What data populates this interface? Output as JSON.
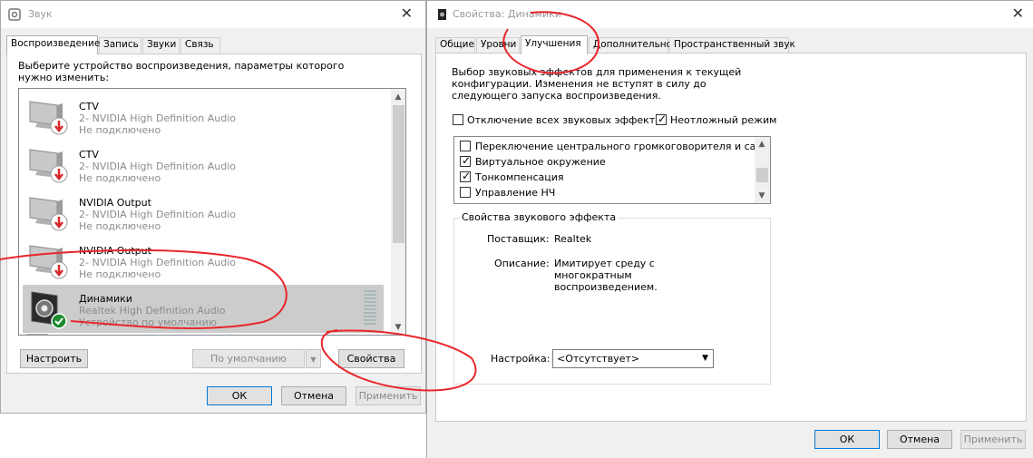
{
  "sound_window": {
    "title": "Звук",
    "tabs": [
      "Воспроизведение",
      "Запись",
      "Звуки",
      "Связь"
    ],
    "instruction": "Выберите устройство воспроизведения, параметры которого нужно изменить:",
    "devices": [
      {
        "name": "CTV",
        "driver": "2- NVIDIA High Definition Audio",
        "status": "Не подключено"
      },
      {
        "name": "CTV",
        "driver": "2- NVIDIA High Definition Audio",
        "status": "Не подключено"
      },
      {
        "name": "NVIDIA Output",
        "driver": "2- NVIDIA High Definition Audio",
        "status": "Не подключено"
      },
      {
        "name": "NVIDIA Output",
        "driver": "2- NVIDIA High Definition Audio",
        "status": "Не подключено"
      },
      {
        "name": "Динамики",
        "driver": "Realtek High Definition Audio",
        "status": "Устройство по умолчанию"
      }
    ],
    "buttons": {
      "configure": "Настроить",
      "default": "По умолчанию",
      "properties": "Свойства",
      "ok": "ОК",
      "cancel": "Отмена",
      "apply": "Применить"
    }
  },
  "props_window": {
    "title": "Свойства: Динамики",
    "tabs": [
      "Общие",
      "Уровни",
      "Улучшения",
      "Дополнительно",
      "Пространственный звук"
    ],
    "description": "Выбор звуковых эффектов для применения к текущей конфигурации. Изменения не вступят в силу до следующего запуска воспроизведения.",
    "disable_all_label": "Отключение всех звуковых эффектов",
    "immediate_mode_label": "Неотложный режим",
    "effects": [
      {
        "label": "Переключение центрального громкоговорителя и сабв...",
        "checked": false
      },
      {
        "label": "Виртуальное окружение",
        "checked": true
      },
      {
        "label": "Тонкомпенсация",
        "checked": true
      },
      {
        "label": "Управление НЧ",
        "checked": false
      }
    ],
    "effect_props": {
      "group_title": "Свойства звукового эффекта",
      "provider_label": "Поставщик:",
      "provider_value": "Realtek",
      "description_label": "Описание:",
      "description_value": "Имитирует среду с многократным воспроизведением.",
      "setting_label": "Настройка:",
      "setting_value": "<Отсутствует>"
    },
    "buttons": {
      "ok": "ОК",
      "cancel": "Отмена",
      "apply": "Применить"
    }
  },
  "colors": {
    "annotation_red": "#e8262b",
    "selection_gray": "#cccccc",
    "focus_blue": "#0078d7",
    "check_green": "#1e8a2e",
    "disconnected_red": "#d42a2a"
  }
}
